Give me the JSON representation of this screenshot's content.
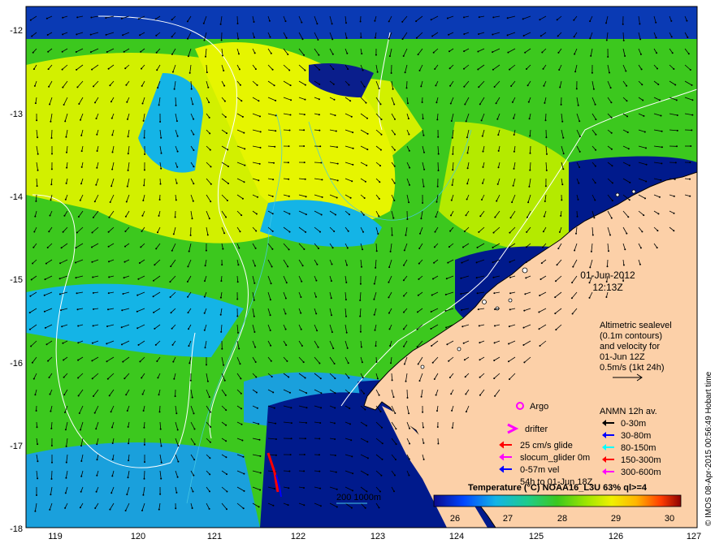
{
  "map": {
    "lon_ticks": [
      "119",
      "120",
      "121",
      "122",
      "123",
      "124",
      "125",
      "126",
      "127"
    ],
    "lat_ticks": [
      "-12",
      "-13",
      "-14",
      "-15",
      "-16",
      "-17",
      "-18"
    ],
    "lon_range": [
      118.62,
      127.0
    ],
    "lat_range": [
      -11.8,
      -18.0
    ]
  },
  "datetime": {
    "date": "01-Jun-2012",
    "time": "12:13Z"
  },
  "altimetry_note": [
    "Altimetric sealevel",
    "(0.1m contours)",
    "and velocity for",
    "01-Jun 12Z",
    "0.5m/s (1kt 24h)"
  ],
  "legend": {
    "argo": "Argo",
    "drifter": "drifter",
    "glider_items": [
      {
        "label": "25 cm/s glide",
        "color": "#ff0000"
      },
      {
        "label": "slocum_glider 0m",
        "color": "#ff00ff"
      },
      {
        "label": "0-57m vel",
        "color": "#0000ff"
      },
      {
        "label": "54h to 01-Jun 18Z",
        "color": ""
      }
    ],
    "anmn_title": "ANMN 12h av.",
    "anmn_items": [
      {
        "label": "0-30m",
        "color": "#000000"
      },
      {
        "label": "30-80m",
        "color": "#0000ff"
      },
      {
        "label": "80-150m",
        "color": "#00ffff"
      },
      {
        "label": "150-300m",
        "color": "#ff0000"
      },
      {
        "label": "300-600m",
        "color": "#ff00ff"
      }
    ]
  },
  "bathymetry_label": "200  1000m",
  "colorbar": {
    "title": "Temperature (°C) NOAA16_L3U 63% ql>=4",
    "ticks": [
      "26",
      "27",
      "28",
      "29",
      "30"
    ],
    "range": [
      25.3,
      30.6
    ]
  },
  "credit": "© IMOS 08-Apr-2015 00:56:49 Hobart time",
  "colors": {
    "land": "#fcd0a8",
    "ocean_deep_blue": "#001a8c",
    "ocean_green": "#3cc81e",
    "ocean_yellow": "#d2f000",
    "ocean_cyan": "#14b4e6"
  }
}
